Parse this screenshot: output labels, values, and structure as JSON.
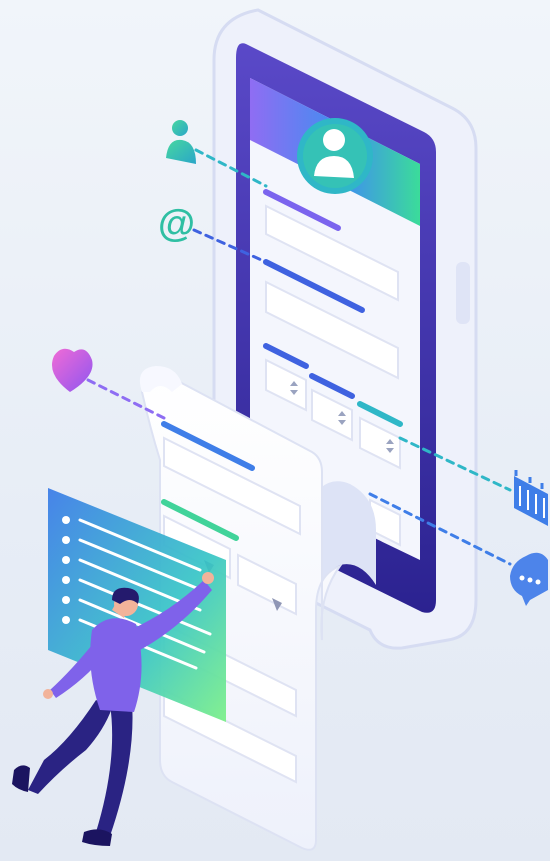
{
  "illustration": {
    "theme": "online form / mobile registration",
    "colors": {
      "background": "#eaf0f7",
      "phone_body": "#eef1fb",
      "phone_edge": "#d3daf2",
      "screen_dark": "#3b2f9a",
      "screen_light": "#f4f6fd",
      "accent_blue": "#3f7ee8",
      "accent_green": "#41d39a",
      "accent_purple": "#7a5cf0",
      "accent_teal": "#2fb7c7",
      "heart_pink": "#e463d9",
      "person_shirt": "#7f62ea",
      "person_pants": "#2a2383",
      "person_hair": "#241a6d"
    },
    "icons": [
      "user-icon",
      "at-sign-icon",
      "heart-icon",
      "calendar-icon",
      "chat-bubble-icon",
      "avatar-icon",
      "dropdown-arrow-icon"
    ],
    "at_symbol": "@"
  }
}
